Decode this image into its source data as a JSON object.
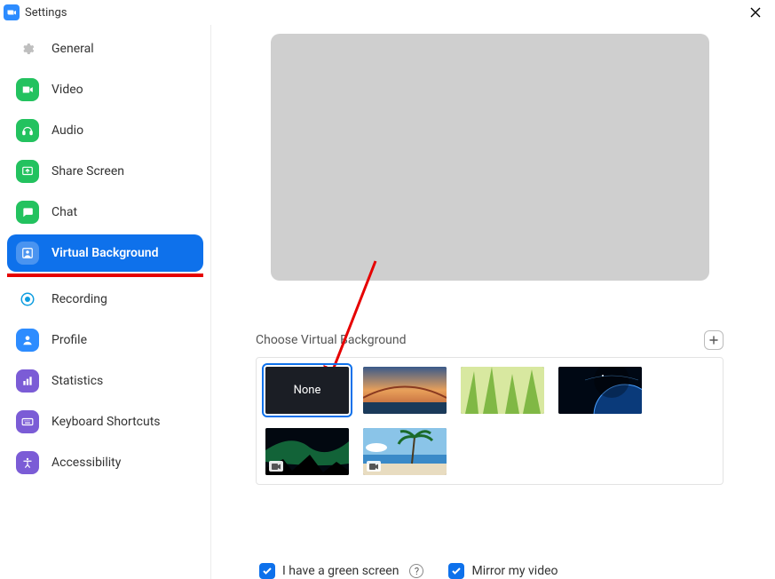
{
  "window": {
    "title": "Settings"
  },
  "sidebar": {
    "items": [
      {
        "label": "General",
        "icon": "gear",
        "iconColor": "#bfbfbf"
      },
      {
        "label": "Video",
        "icon": "video",
        "iconColor": "#23c25f"
      },
      {
        "label": "Audio",
        "icon": "audio",
        "iconColor": "#23c25f"
      },
      {
        "label": "Share Screen",
        "icon": "share",
        "iconColor": "#23c25f"
      },
      {
        "label": "Chat",
        "icon": "chat",
        "iconColor": "#23c25f"
      },
      {
        "label": "Virtual Background",
        "icon": "portrait",
        "iconColor": "#0e71eb",
        "active": true,
        "underline": true
      },
      {
        "label": "Recording",
        "icon": "record",
        "iconColor": "#0e9de0"
      },
      {
        "label": "Profile",
        "icon": "profile",
        "iconColor": "#2d8cff"
      },
      {
        "label": "Statistics",
        "icon": "stats",
        "iconColor": "#7b5cd6"
      },
      {
        "label": "Keyboard Shortcuts",
        "icon": "keyboard",
        "iconColor": "#7b5cd6"
      },
      {
        "label": "Accessibility",
        "icon": "accessibility",
        "iconColor": "#7b5cd6"
      }
    ]
  },
  "main": {
    "choose_label": "Choose Virtual Background",
    "thumbs": {
      "none_label": "None",
      "items": [
        "none",
        "bridge",
        "grass",
        "earth",
        "aurora",
        "beach"
      ]
    },
    "green_screen_label": "I have a green screen",
    "mirror_label": "Mirror my video",
    "green_screen_checked": true,
    "mirror_checked": true
  }
}
